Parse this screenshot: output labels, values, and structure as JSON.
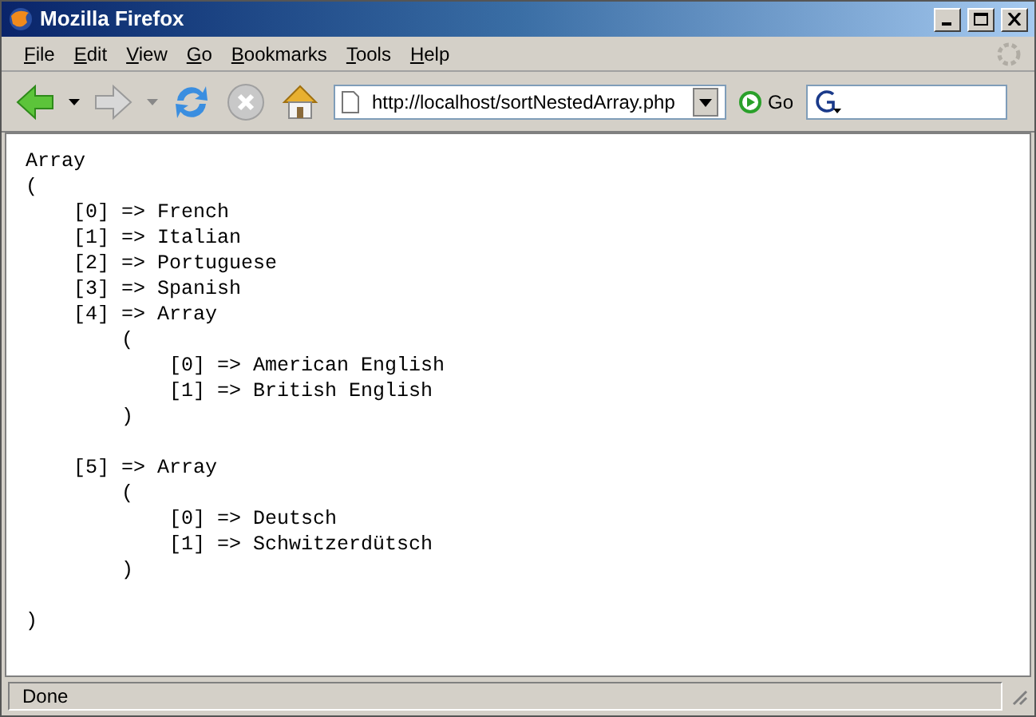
{
  "window": {
    "title": "Mozilla Firefox"
  },
  "menu": [
    "File",
    "Edit",
    "View",
    "Go",
    "Bookmarks",
    "Tools",
    "Help"
  ],
  "toolbar": {
    "address": "http://localhost/sortNestedArray.php",
    "go": "Go"
  },
  "content": {
    "text": "Array\n(\n    [0] => French\n    [1] => Italian\n    [2] => Portuguese\n    [3] => Spanish\n    [4] => Array\n        (\n            [0] => American English\n            [1] => British English\n        )\n\n    [5] => Array\n        (\n            [0] => Deutsch\n            [1] => Schwitzerdütsch\n        )\n\n)"
  },
  "status_bar": {
    "text": "Done"
  }
}
